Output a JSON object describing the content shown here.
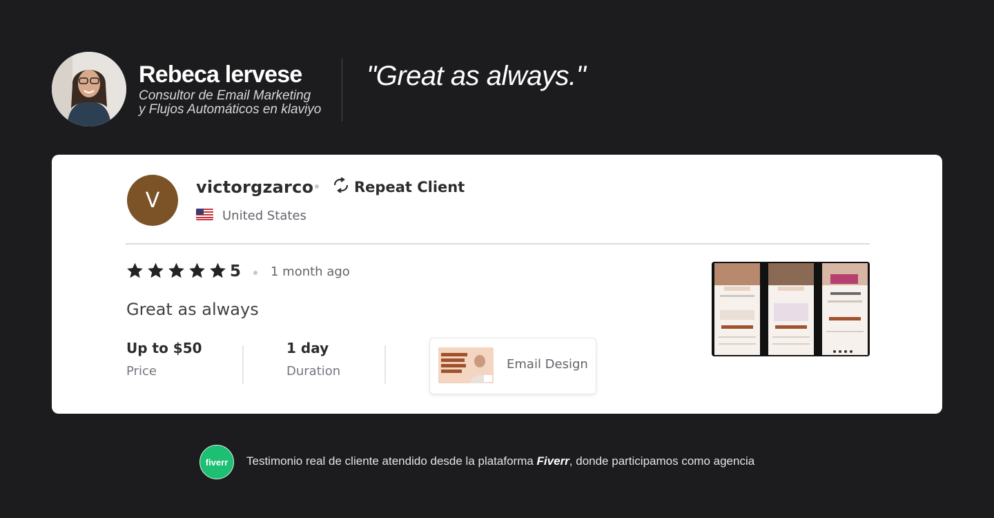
{
  "header": {
    "name": "Rebeca lervese",
    "role_line1": "Consultor de Email Marketing",
    "role_line2": "y Flujos Automáticos en klaviyo",
    "quote": "\"Great as always.\""
  },
  "review": {
    "client_initial": "V",
    "client_name": "victorgzarco",
    "repeat_label": "Repeat Client",
    "country": "United States",
    "rating": "5",
    "stars_filled": 5,
    "time_ago": "1 month ago",
    "text": "Great as always",
    "price_value": "Up to $50",
    "price_label": "Price",
    "duration_value": "1 day",
    "duration_label": "Duration",
    "gig_label": "Email Design"
  },
  "footer": {
    "badge_text": "fiverr",
    "text_before": "Testimonio real de cliente atendido desde la plataforma ",
    "platform": "Fiverr",
    "text_after": ", donde participamos como agencia"
  },
  "colors": {
    "background": "#1c1b1d",
    "card": "#ffffff",
    "client_avatar": "#7b5327",
    "fiverr_green": "#1dbf73",
    "star": "#222325"
  }
}
